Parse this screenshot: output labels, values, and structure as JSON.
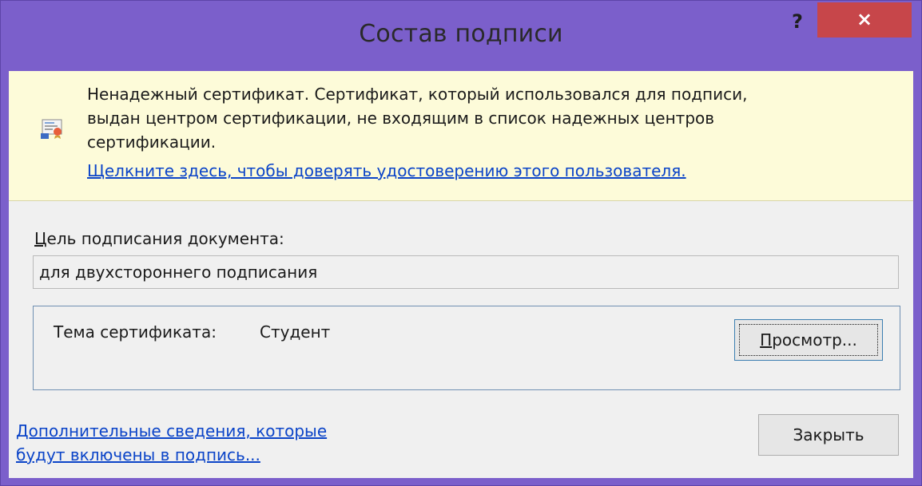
{
  "window": {
    "title": "Состав подписи",
    "help_label": "?",
    "close_label": "×"
  },
  "warning": {
    "line1": "Ненадежный сертификат. Сертификат, который использовался для подписи,",
    "line2": "выдан центром сертификации, не входящим в список надежных центров",
    "line3": "сертификации.",
    "trust_link": "Щелкните здесь, чтобы доверять удостоверению этого пользователя.",
    "icon": "untrusted-certificate-icon"
  },
  "purpose": {
    "label_mnemonic": "Ц",
    "label_rest": "ель подписания документа:",
    "value": "для двухстороннего подписания"
  },
  "certificate": {
    "subject_label": "Тема сертификата:",
    "subject_value": "Студент",
    "view_mnemonic": "П",
    "view_rest": "росмотр..."
  },
  "footer": {
    "extra_link_line1": "Дополнительные сведения, которые",
    "extra_link_line2": "будут включены в подпись...",
    "close_button": "Закрыть"
  },
  "colors": {
    "frame": "#7b5fcb",
    "close_button": "#c7464a",
    "warning_bar": "#fdfbd9",
    "link": "#0b44c8"
  }
}
